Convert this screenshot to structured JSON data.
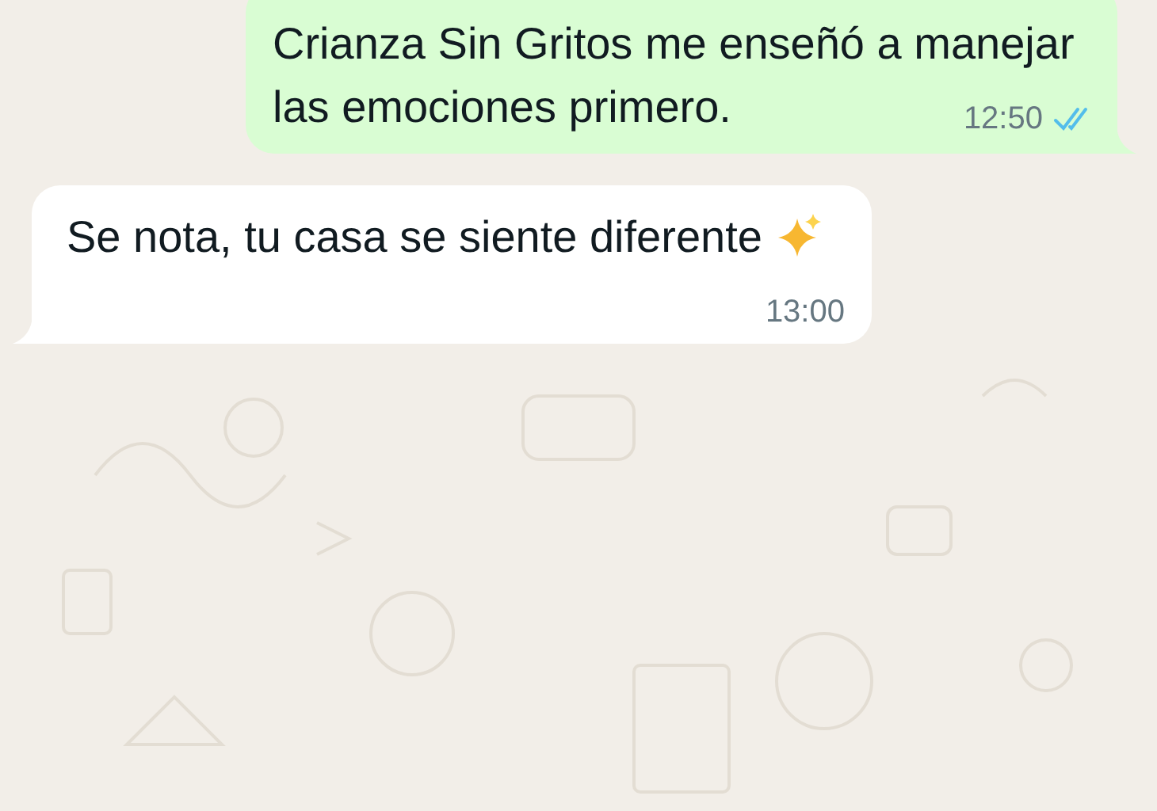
{
  "messages": [
    {
      "kind": "outgoing",
      "lines": [
        "Crianza Sin Gritos me enseñó a manejar",
        "las emociones primero."
      ],
      "time": "12:50",
      "read": true
    },
    {
      "kind": "incoming",
      "lines": [
        "Se nota, tu casa se siente diferente"
      ],
      "time": "13:00",
      "sparkles": true
    }
  ]
}
